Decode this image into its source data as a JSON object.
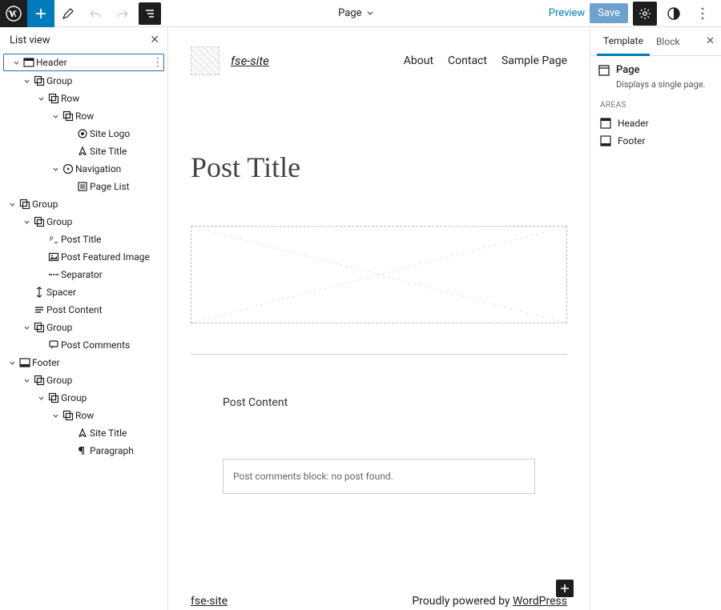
{
  "topbar": {
    "doc_label": "Page",
    "preview": "Preview",
    "save": "Save"
  },
  "list_view": {
    "title": "List view",
    "items": [
      {
        "level": 1,
        "chev": "down",
        "icon": "header",
        "label": "Header",
        "selected": true,
        "more": true
      },
      {
        "level": 2,
        "chev": "down",
        "icon": "group",
        "label": "Group"
      },
      {
        "level": 3,
        "chev": "down",
        "icon": "row",
        "label": "Row"
      },
      {
        "level": 4,
        "chev": "down",
        "icon": "row",
        "label": "Row"
      },
      {
        "level": 5,
        "chev": "",
        "icon": "site-logo",
        "label": "Site Logo"
      },
      {
        "level": 5,
        "chev": "",
        "icon": "site-title",
        "label": "Site Title"
      },
      {
        "level": 4,
        "chev": "down",
        "icon": "nav",
        "label": "Navigation"
      },
      {
        "level": 5,
        "chev": "",
        "icon": "page-list",
        "label": "Page List"
      },
      {
        "level": 1,
        "chev": "down",
        "icon": "group",
        "label": "Group"
      },
      {
        "level": 2,
        "chev": "down",
        "icon": "group",
        "label": "Group"
      },
      {
        "level": 3,
        "chev": "",
        "icon": "post-title",
        "label": "Post Title"
      },
      {
        "level": 3,
        "chev": "",
        "icon": "image",
        "label": "Post Featured Image"
      },
      {
        "level": 3,
        "chev": "",
        "icon": "separator",
        "label": "Separator"
      },
      {
        "level": 2,
        "chev": "",
        "icon": "spacer",
        "label": "Spacer"
      },
      {
        "level": 2,
        "chev": "",
        "icon": "post-content",
        "label": "Post Content"
      },
      {
        "level": 2,
        "chev": "down",
        "icon": "group",
        "label": "Group"
      },
      {
        "level": 3,
        "chev": "",
        "icon": "comments",
        "label": "Post Comments"
      },
      {
        "level": 1,
        "chev": "down",
        "icon": "footer",
        "label": "Footer"
      },
      {
        "level": 2,
        "chev": "down",
        "icon": "group",
        "label": "Group"
      },
      {
        "level": 3,
        "chev": "down",
        "icon": "group",
        "label": "Group"
      },
      {
        "level": 4,
        "chev": "down",
        "icon": "row",
        "label": "Row"
      },
      {
        "level": 5,
        "chev": "",
        "icon": "site-title",
        "label": "Site Title"
      },
      {
        "level": 5,
        "chev": "",
        "icon": "paragraph",
        "label": "Paragraph"
      }
    ]
  },
  "canvas": {
    "site_title": "fse-site",
    "nav": [
      "About",
      "Contact",
      "Sample Page"
    ],
    "post_title": "Post Title",
    "post_content_label": "Post Content",
    "comments_msg": "Post comments block: no post found.",
    "footer_site": "fse-site",
    "footer_powered_pre": "Proudly powered by ",
    "footer_powered_link": "WordPress"
  },
  "right": {
    "tab_template": "Template",
    "tab_block": "Block",
    "page_label": "Page",
    "page_desc": "Displays a single page.",
    "areas_heading": "AREAS",
    "areas": [
      "Header",
      "Footer"
    ]
  }
}
